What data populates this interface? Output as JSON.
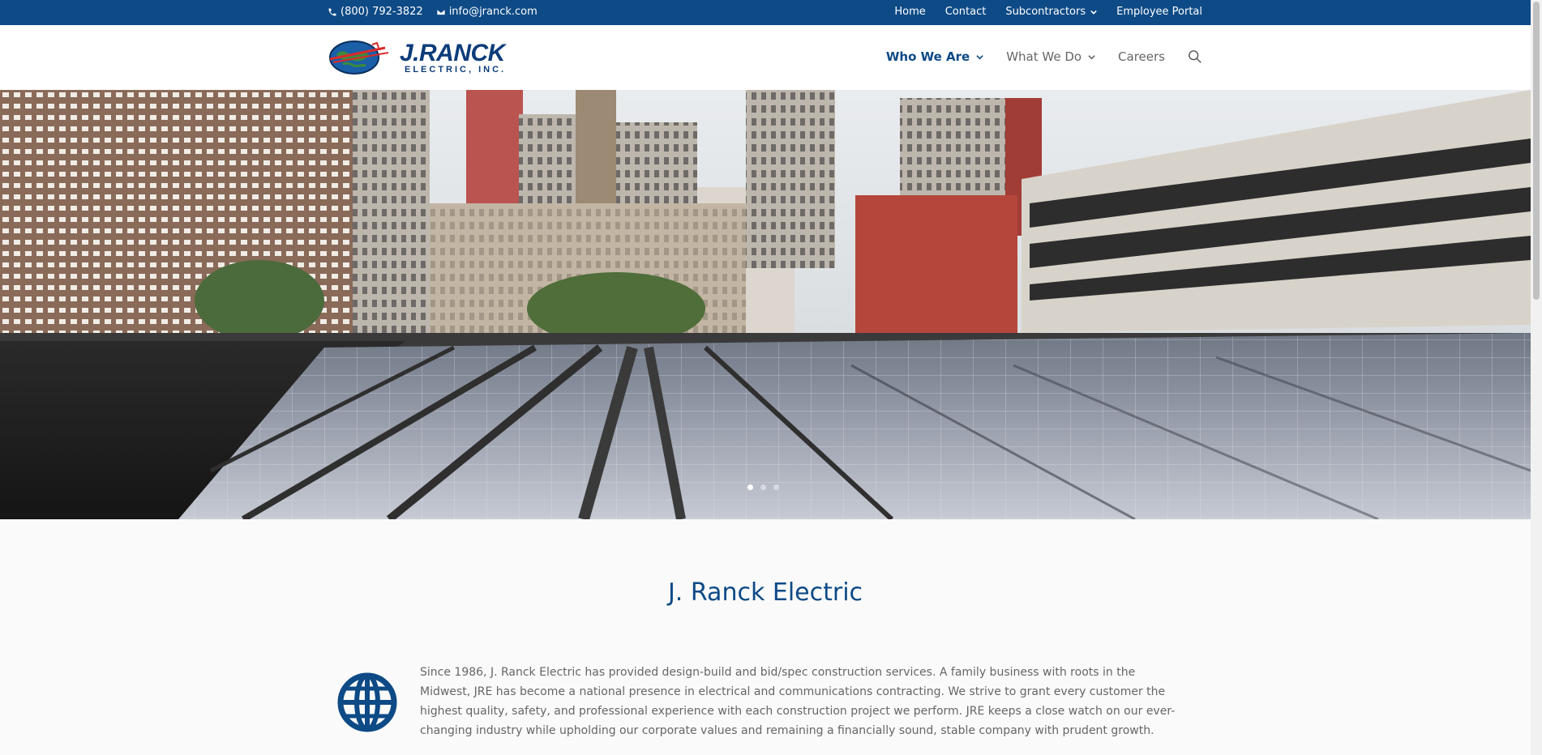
{
  "topbar": {
    "phone": "(800) 792-3822",
    "email": "info@jranck.com",
    "nav": [
      {
        "label": "Home"
      },
      {
        "label": "Contact"
      },
      {
        "label": "Subcontractors",
        "has_dropdown": true
      },
      {
        "label": "Employee Portal"
      }
    ],
    "bg_color": "#0d4a86"
  },
  "header": {
    "logo": {
      "name": "J.RANCK",
      "sub": "ELECTRIC, INC."
    },
    "nav": [
      {
        "label": "Who We Are",
        "has_dropdown": true,
        "active": true
      },
      {
        "label": "What We Do",
        "has_dropdown": true,
        "active": false
      },
      {
        "label": "Careers",
        "has_dropdown": false,
        "active": false
      }
    ],
    "search_icon": "search-icon"
  },
  "hero": {
    "slides": 3,
    "active_slide": 1
  },
  "content": {
    "title": "J. Ranck Electric",
    "icon": "globe-icon",
    "intro": "Since 1986, J. Ranck Electric has provided design-build and bid/spec construction services. A family business with roots in the Midwest, JRE has become a national presence in electrical and communications contracting. We strive to grant every customer the highest quality, safety, and professional experience with each construction project we perform. JRE keeps a close watch on our ever-changing industry while upholding our corporate values and remaining a financially sound, stable company with prudent growth."
  },
  "colors": {
    "accent": "#0d4a86",
    "text_muted": "#666666"
  }
}
